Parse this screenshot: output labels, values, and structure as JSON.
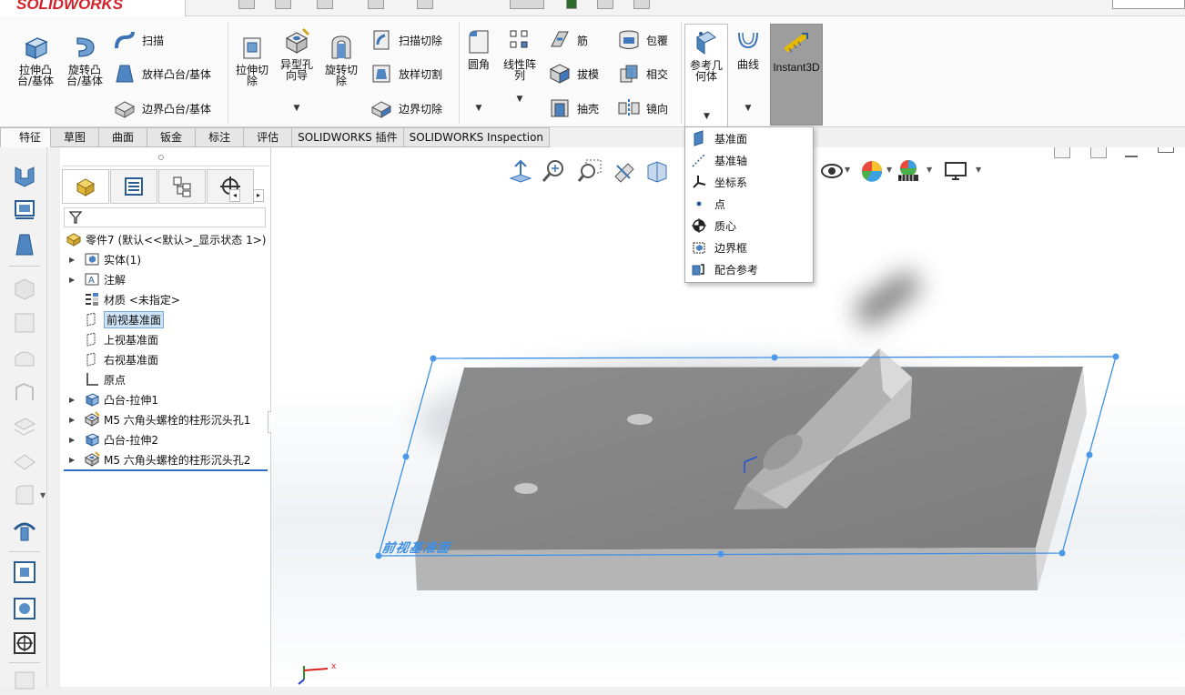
{
  "app": {
    "logo_text": "SOLIDWORKS"
  },
  "toolbar": {
    "extrude_boss": "拉伸凸\n台/基体",
    "revolve_boss": "旋转凸\n台/基体",
    "sweep": "扫描",
    "loft_boss": "放样凸台/基体",
    "boundary_boss": "边界凸台/基体",
    "extrude_cut": "拉伸切\n除",
    "hole_wizard": "异型孔\n向导",
    "revolve_cut": "旋转切\n除",
    "swept_cut": "扫描切除",
    "lofted_cut": "放样切割",
    "boundary_cut": "边界切除",
    "fillet": "圆角",
    "linear_pattern": "线性阵\n列",
    "rib": "筋",
    "draft": "拔模",
    "shell": "抽壳",
    "wrap": "包覆",
    "intersect": "相交",
    "mirror": "镜向",
    "reference_geometry": "参考几\n何体",
    "curves": "曲线",
    "instant3d": "Instant3D"
  },
  "tabs": [
    {
      "label": "特征",
      "active": true
    },
    {
      "label": "草图"
    },
    {
      "label": "曲面"
    },
    {
      "label": "钣金"
    },
    {
      "label": "标注"
    },
    {
      "label": "评估"
    },
    {
      "label": "SOLIDWORKS 插件"
    },
    {
      "label": "SOLIDWORKS Inspection"
    }
  ],
  "feature_tree": {
    "root": "零件7 (默认<<默认>_显示状态 1>)",
    "items": [
      {
        "label": "实体(1)",
        "expandable": true
      },
      {
        "label": "注解",
        "expandable": true
      },
      {
        "label": "材质 <未指定>",
        "expandable": false
      },
      {
        "label": "前视基准面",
        "expandable": false,
        "selected": true
      },
      {
        "label": "上视基准面",
        "expandable": false
      },
      {
        "label": "右视基准面",
        "expandable": false
      },
      {
        "label": "原点",
        "expandable": false
      },
      {
        "label": "凸台-拉伸1",
        "expandable": true
      },
      {
        "label": "M5 六角头螺栓的柱形沉头孔1",
        "expandable": true
      },
      {
        "label": "凸台-拉伸2",
        "expandable": true
      },
      {
        "label": "M5 六角头螺栓的柱形沉头孔2",
        "expandable": true
      }
    ]
  },
  "ref_geometry_menu": {
    "items": [
      {
        "label": "基准面",
        "icon": "plane-icon"
      },
      {
        "label": "基准轴",
        "icon": "axis-icon"
      },
      {
        "label": "坐标系",
        "icon": "coordinate-system-icon"
      },
      {
        "label": "点",
        "icon": "point-icon"
      },
      {
        "label": "质心",
        "icon": "center-of-mass-icon"
      },
      {
        "label": "边界框",
        "icon": "bounding-box-icon"
      },
      {
        "label": "配合参考",
        "icon": "mate-reference-icon"
      }
    ]
  },
  "viewport": {
    "plane_label": "前视基准面",
    "triad_x": "x",
    "selection_color": "#3b8fe6",
    "model_color": "#8a8a8a"
  }
}
